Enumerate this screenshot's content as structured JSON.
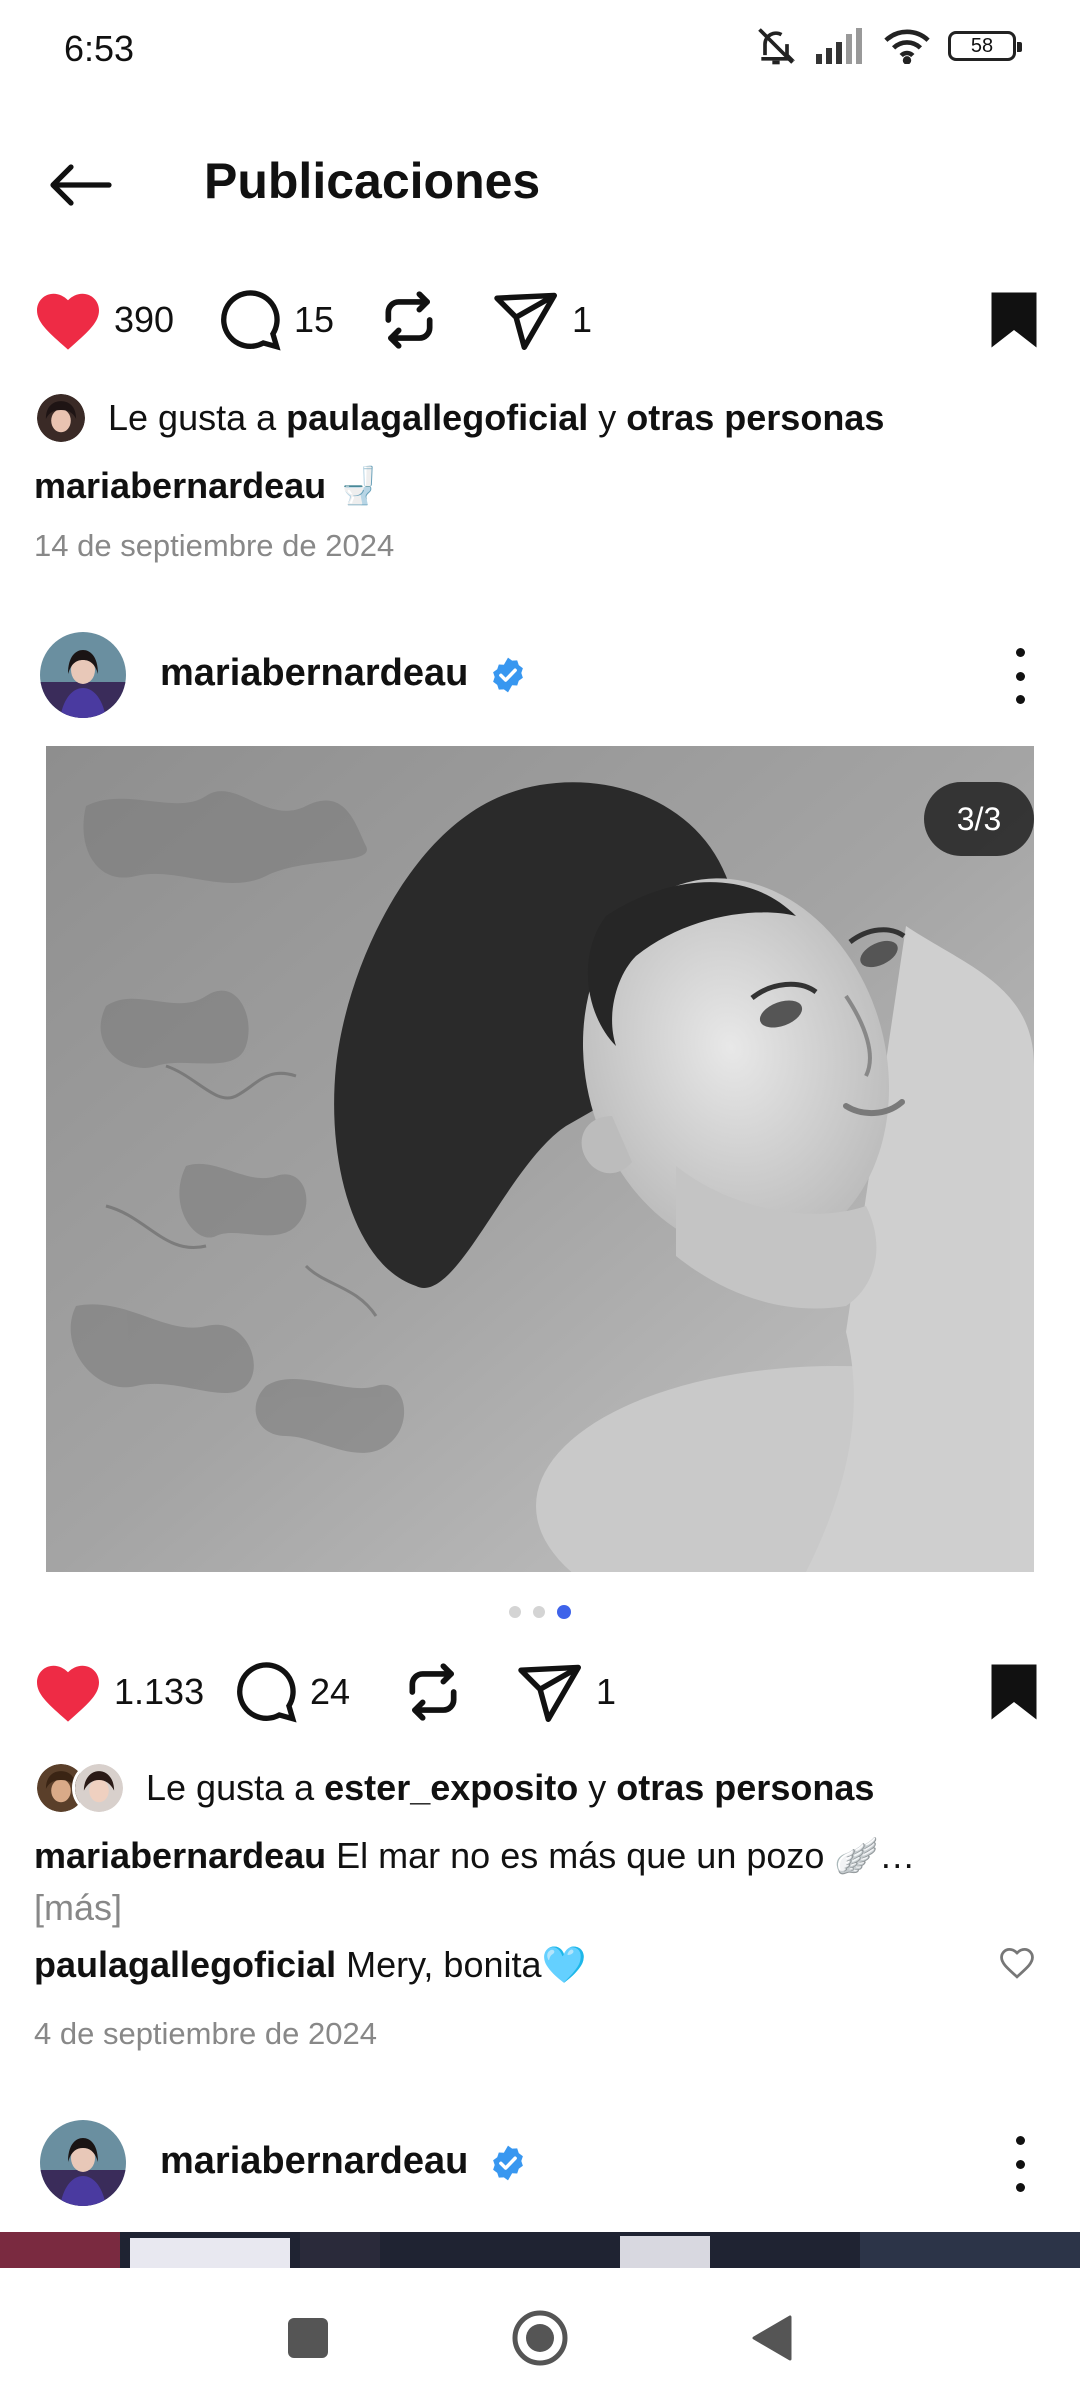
{
  "status_bar": {
    "time": "6:53",
    "battery": "58"
  },
  "header": {
    "title": "Publicaciones"
  },
  "post1": {
    "likes_count": "390",
    "comments_count": "15",
    "shares_count": "1",
    "liked_by_prefix": "Le gusta a ",
    "liked_by_user": "paulagallegoficial",
    "liked_by_joiner": " y ",
    "liked_by_others": "otras personas",
    "caption_user": "mariabernardeau",
    "caption_text": " 🚽",
    "date": "14 de septiembre de 2024"
  },
  "post2": {
    "username": "mariabernardeau",
    "image_counter": "3/3",
    "carousel_active_index": 3,
    "carousel_total": 3,
    "likes_count": "1.133",
    "comments_count": "24",
    "shares_count": "1",
    "liked_by_prefix": "Le gusta a ",
    "liked_by_user": "ester_exposito",
    "liked_by_joiner": " y ",
    "liked_by_others": "otras personas",
    "caption_user": "mariabernardeau",
    "caption_text": " El mar no es más que un pozo 🪽…",
    "more_label": "[más]",
    "comment_user": "paulagallegoficial",
    "comment_text": " Mery, bonita🩵",
    "date": "4 de septiembre de 2024"
  },
  "post3": {
    "username": "mariabernardeau"
  },
  "colors": {
    "like_red": "#ee2b45",
    "verified_blue": "#3897f0",
    "carousel_active": "#3e63ea"
  },
  "icons": {
    "like": "heart-icon",
    "comment": "comment-icon",
    "repost": "repost-icon",
    "share": "send-icon",
    "save": "bookmark-icon",
    "menu": "more-vert-icon",
    "back": "arrow-left-icon"
  }
}
